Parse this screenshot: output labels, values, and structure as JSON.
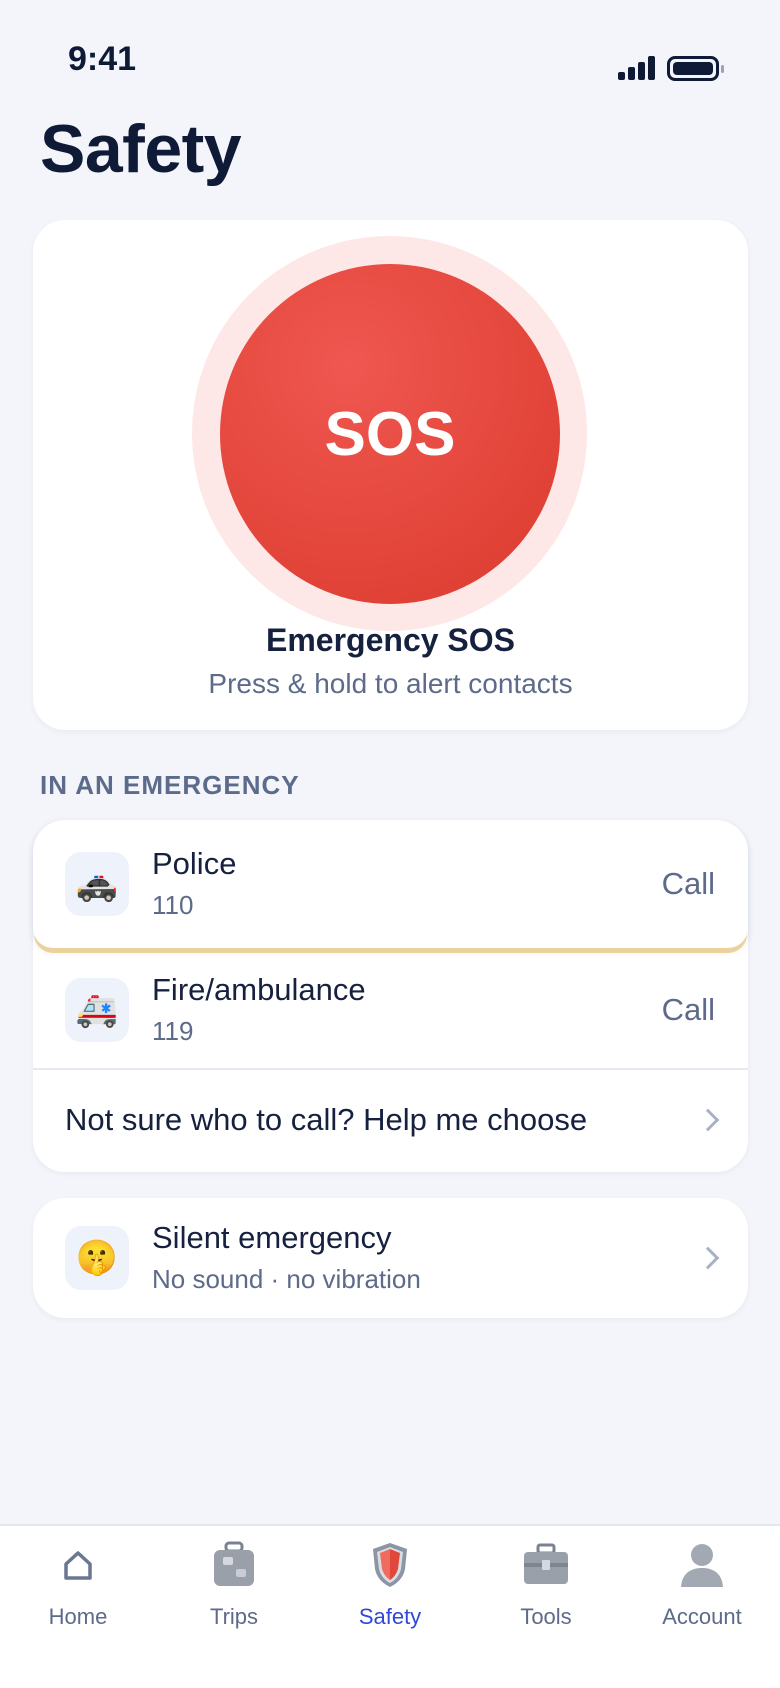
{
  "status_bar": {
    "time": "9:41"
  },
  "page": {
    "title": "Safety"
  },
  "sos": {
    "button_label": "SOS",
    "title": "Emergency SOS",
    "subtitle": "Press & hold to alert contacts"
  },
  "emergency": {
    "section_label": "IN AN EMERGENCY",
    "contacts": [
      {
        "icon": "police-car-icon",
        "emoji": "🚓",
        "name": "Police",
        "number": "110",
        "action": "Call"
      },
      {
        "icon": "ambulance-icon",
        "emoji": "🚑",
        "name": "Fire/ambulance",
        "number": "119",
        "action": "Call"
      }
    ],
    "help_label": "Not sure who to call? Help me choose"
  },
  "silent": {
    "icon": "shushing-face-icon",
    "emoji": "🤫",
    "title": "Silent emergency",
    "subtitle": "No sound · no vibration"
  },
  "tab_bar": {
    "active": "Safety",
    "tabs": [
      {
        "label": "Home",
        "icon": "home-icon"
      },
      {
        "label": "Trips",
        "icon": "luggage-icon"
      },
      {
        "label": "Safety",
        "icon": "shield-icon"
      },
      {
        "label": "Tools",
        "icon": "toolbox-icon"
      },
      {
        "label": "Account",
        "icon": "person-icon"
      }
    ]
  },
  "colors": {
    "background": "#f3f5fa",
    "sos_red": "#e64a40",
    "sos_halo": "#fde8e7",
    "accent_blue": "#2f48d8",
    "text_dark": "#16213f",
    "text_muted": "#5d6a8a",
    "highlight_underline": "#ead29a"
  }
}
